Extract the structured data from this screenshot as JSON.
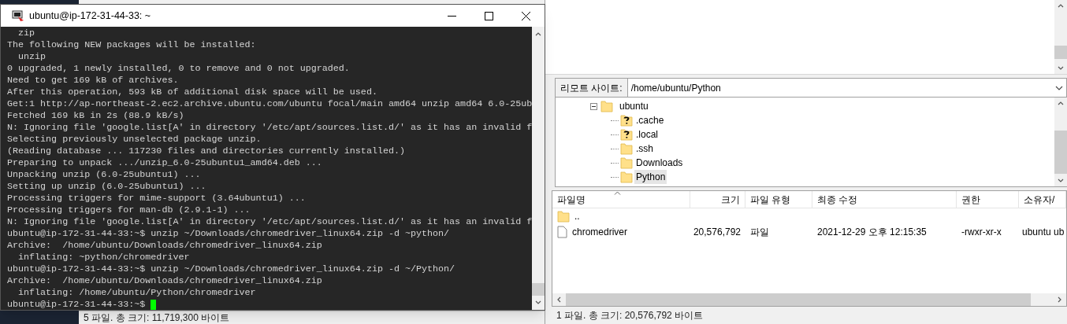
{
  "terminal": {
    "title": "ubuntu@ip-172-31-44-33: ~",
    "lines": [
      "  zip",
      "The following NEW packages will be installed:",
      "  unzip",
      "0 upgraded, 1 newly installed, 0 to remove and 0 not upgraded.",
      "Need to get 169 kB of archives.",
      "After this operation, 593 kB of additional disk space will be used.",
      "Get:1 http://ap-northeast-2.ec2.archive.ubuntu.com/ubuntu focal/main amd64 unzip amd64 6.0-25ub",
      "Fetched 169 kB in 2s (88.9 kB/s)",
      "N: Ignoring file 'google.list[A' in directory '/etc/apt/sources.list.d/' as it has an invalid f",
      "Selecting previously unselected package unzip.",
      "(Reading database ... 117230 files and directories currently installed.)",
      "Preparing to unpack .../unzip_6.0-25ubuntu1_amd64.deb ...",
      "Unpacking unzip (6.0-25ubuntu1) ...",
      "Setting up unzip (6.0-25ubuntu1) ...",
      "Processing triggers for mime-support (3.64ubuntu1) ...",
      "Processing triggers for man-db (2.9.1-1) ...",
      "N: Ignoring file 'google.list[A' in directory '/etc/apt/sources.list.d/' as it has an invalid f",
      "ubuntu@ip-172-31-44-33:~$ unzip ~/Downloads/chromedriver_linux64.zip -d ~python/",
      "Archive:  /home/ubuntu/Downloads/chromedriver_linux64.zip",
      "  inflating: ~python/chromedriver",
      "ubuntu@ip-172-31-44-33:~$ unzip ~/Downloads/chromedriver_linux64.zip -d ~/Python/",
      "Archive:  /home/ubuntu/Downloads/chromedriver_linux64.zip",
      "  inflating: /home/ubuntu/Python/chromedriver",
      "ubuntu@ip-172-31-44-33:~$ "
    ]
  },
  "local": {
    "status": "5 파일. 총 크기: 11,719,300 바이트"
  },
  "remote": {
    "site_label": "리모트 사이트:",
    "path": "/home/ubuntu/Python",
    "tree": {
      "label": "ubuntu",
      "expanded": true,
      "children": [
        {
          "label": ".cache",
          "kind": "unknown",
          "selected": false
        },
        {
          "label": ".local",
          "kind": "unknown",
          "selected": false
        },
        {
          "label": ".ssh",
          "kind": "folder",
          "selected": false
        },
        {
          "label": "Downloads",
          "kind": "folder",
          "selected": false
        },
        {
          "label": "Python",
          "kind": "folder",
          "selected": true
        }
      ]
    },
    "file_list": {
      "columns": [
        {
          "label": "파일명",
          "sorted": true
        },
        {
          "label": "크기",
          "sorted": false
        },
        {
          "label": "파일 유형",
          "sorted": false
        },
        {
          "label": "최종 수정",
          "sorted": false
        },
        {
          "label": "권한",
          "sorted": false
        },
        {
          "label": "소유자/",
          "sorted": false
        }
      ],
      "rows": [
        {
          "kind": "folder",
          "cells": [
            ".."
          ]
        },
        {
          "kind": "file",
          "cells": [
            "chromedriver",
            "20,576,792",
            "파일",
            "2021-12-29 오후 12:15:35",
            "-rwxr-xr-x",
            "ubuntu ub"
          ]
        }
      ]
    },
    "status": "1 파일. 총 크기: 20,576,792 바이트"
  }
}
